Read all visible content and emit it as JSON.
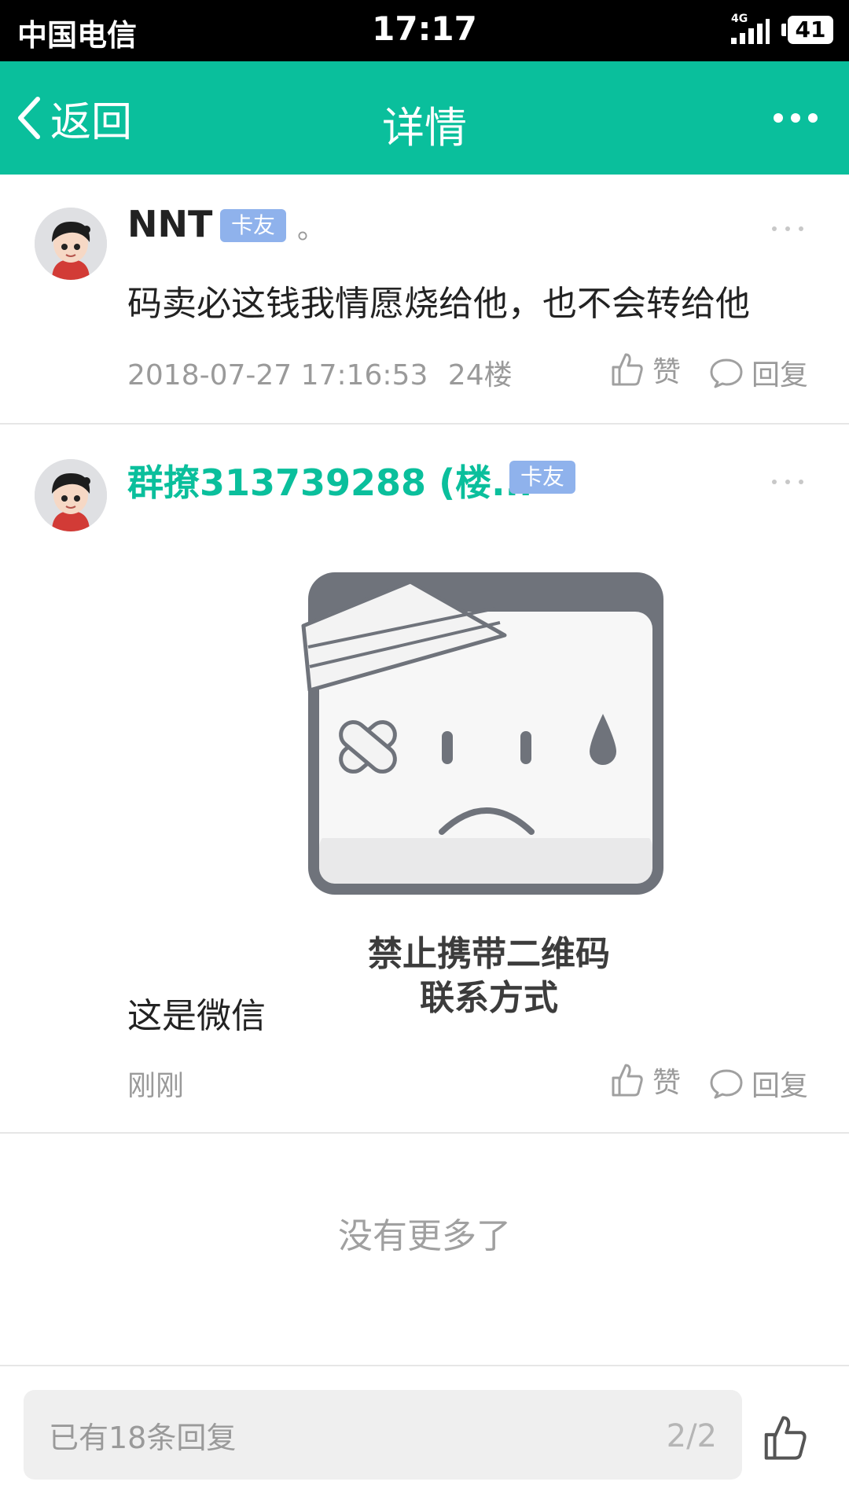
{
  "status_bar": {
    "carrier": "中国电信",
    "time": "17:17",
    "network": "4G",
    "battery": "41"
  },
  "nav": {
    "back_label": "返回",
    "title": "详情"
  },
  "replies": [
    {
      "username": "NNT",
      "badge": "卡友",
      "suffix": "。",
      "text": "码卖必这钱我情愿烧给他，也不会转给他",
      "timestamp": "2018-07-27 17:16:53",
      "floor": "24楼",
      "like_label": "赞",
      "reply_label": "回复"
    },
    {
      "username": "群撩313739288 (楼...",
      "badge": "卡友",
      "image_caption_line1": "禁止携带二维码",
      "image_caption_line2": "联系方式",
      "text": "这是微信",
      "timestamp": "刚刚",
      "like_label": "赞",
      "reply_label": "回复"
    }
  ],
  "no_more": "没有更多了",
  "bottom": {
    "placeholder": "已有18条回复",
    "page_indicator": "2/2"
  },
  "colors": {
    "accent": "#0abf9c",
    "badge": "#8fb2ec",
    "username_highlight": "#0abf9c"
  }
}
